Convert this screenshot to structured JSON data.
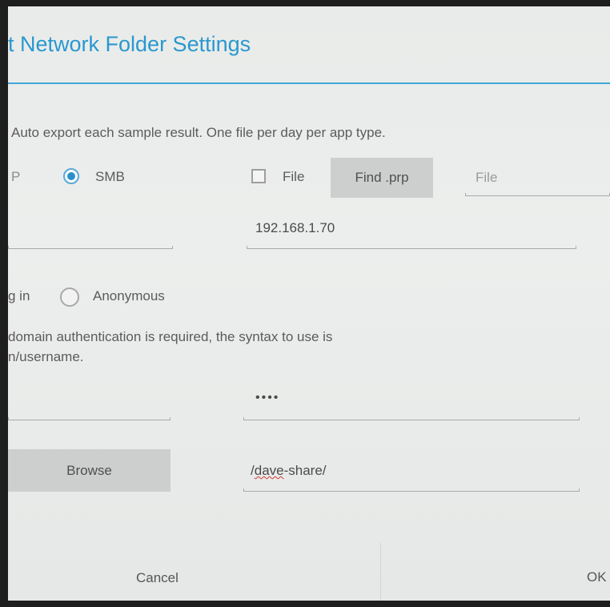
{
  "dialog": {
    "title": "t Network Folder Settings",
    "description": "Auto export each sample result. One file per day per app type."
  },
  "protocol": {
    "ftp_label_partial": "P",
    "smb_label": "SMB",
    "smb_selected": true
  },
  "file_option": {
    "label": "File",
    "checked": false,
    "find_button": "Find .prp",
    "file_placeholder": "File"
  },
  "server": {
    "ip_address": "192.168.1.70"
  },
  "login": {
    "login_label_partial": "g in",
    "anonymous_label": "Anonymous",
    "anonymous_selected": false,
    "hint_line1": "domain authentication is required, the syntax to use is",
    "hint_line2": "n/username."
  },
  "credentials": {
    "password_masked": "••••"
  },
  "share": {
    "browse_button": "Browse",
    "path_prefix": "/",
    "path_misspelled": "dave",
    "path_suffix": "-share/"
  },
  "footer": {
    "cancel_label": "Cancel",
    "ok_label": "OK"
  },
  "colors": {
    "accent": "#2a98cf",
    "button_bg": "#cdcfce"
  }
}
